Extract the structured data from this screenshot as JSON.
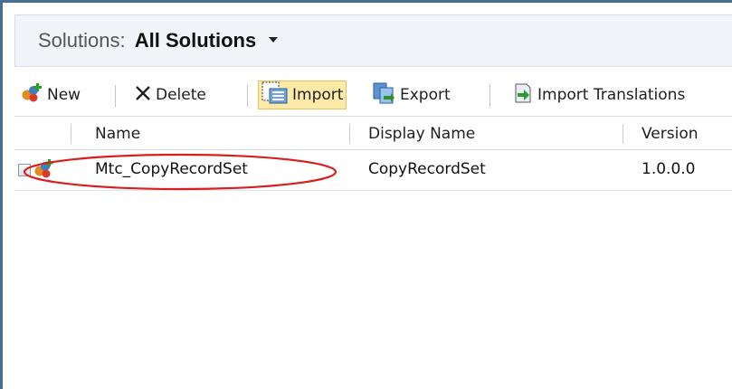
{
  "header": {
    "label": "Solutions:",
    "view_name": "All Solutions"
  },
  "toolbar": {
    "new": "New",
    "delete": "Delete",
    "import": "Import",
    "export": "Export",
    "import_translations": "Import Translations"
  },
  "grid": {
    "columns": [
      "Name",
      "Display Name",
      "Version"
    ],
    "rows": [
      {
        "name": "Mtc_CopyRecordSet",
        "display_name": "CopyRecordSet",
        "version": "1.0.0.0"
      }
    ]
  },
  "colors": {
    "frame": "#4a6d95",
    "header_bg": "#f1f4f8",
    "active_button_bg": "#fdeaa7",
    "annotation": "#d81e1e"
  },
  "icons": [
    "new-solution-icon",
    "delete-x-icon",
    "import-icon",
    "export-icon",
    "import-translations-icon",
    "solution-row-icon",
    "caret-down-icon"
  ]
}
